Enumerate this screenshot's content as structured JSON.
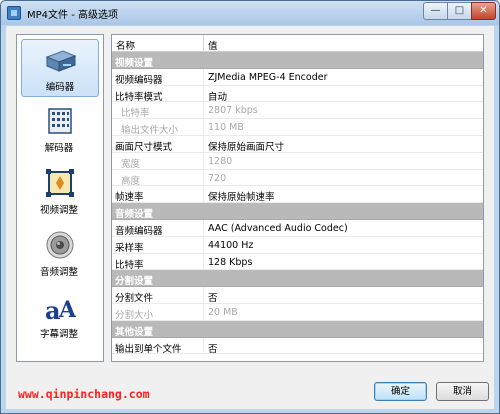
{
  "window": {
    "title": "MP4文件 - 高级选项",
    "caption_buttons": {
      "minimize": "—",
      "maximize": "□",
      "close": "✕"
    }
  },
  "sidebar": {
    "items": [
      {
        "label": "编码器",
        "icon": "encoder-box-icon",
        "selected": true
      },
      {
        "label": "解码器",
        "icon": "decoder-chip-icon",
        "selected": false
      },
      {
        "label": "视频调整",
        "icon": "video-adjust-icon",
        "selected": false
      },
      {
        "label": "音频调整",
        "icon": "speaker-icon",
        "selected": false
      },
      {
        "label": "字幕调整",
        "icon": "subtitle-font-icon",
        "selected": false
      }
    ]
  },
  "grid": {
    "header": {
      "name": "名称",
      "value": "值"
    },
    "rows": [
      {
        "type": "group",
        "name": "视频设置"
      },
      {
        "type": "item",
        "name": "视频编码器",
        "value": "ZJMedia MPEG-4 Encoder"
      },
      {
        "type": "item",
        "name": "比特率模式",
        "value": "自动"
      },
      {
        "type": "sub",
        "name": "比特率",
        "value": "2807 kbps",
        "disabled": true
      },
      {
        "type": "sub",
        "name": "输出文件大小",
        "value": "110 MB",
        "disabled": true
      },
      {
        "type": "item",
        "name": "画面尺寸模式",
        "value": "保持原始画面尺寸"
      },
      {
        "type": "sub",
        "name": "宽度",
        "value": "1280",
        "disabled": true
      },
      {
        "type": "sub",
        "name": "高度",
        "value": "720",
        "disabled": true
      },
      {
        "type": "item",
        "name": "帧速率",
        "value": "保持原始帧速率"
      },
      {
        "type": "group",
        "name": "音频设置"
      },
      {
        "type": "item",
        "name": "音频编码器",
        "value": "AAC (Advanced Audio Codec)"
      },
      {
        "type": "item",
        "name": "采样率",
        "value": "44100 Hz"
      },
      {
        "type": "item",
        "name": "比特率",
        "value": "128 Kbps"
      },
      {
        "type": "group",
        "name": "分割设置"
      },
      {
        "type": "item",
        "name": "分割文件",
        "value": "否"
      },
      {
        "type": "item",
        "name": "分割大小",
        "value": "20 MB",
        "disabled": true
      },
      {
        "type": "group",
        "name": "其他设置"
      },
      {
        "type": "item",
        "name": "输出到单个文件",
        "value": "否"
      }
    ]
  },
  "footer": {
    "watermark": "www.qinpinchang.com",
    "ok_label": "确定",
    "cancel_label": "取消"
  },
  "colors": {
    "group_row_bg": "#b9b9b9",
    "watermark": "#ff2020",
    "selected_bg": "#cbe1f7"
  }
}
